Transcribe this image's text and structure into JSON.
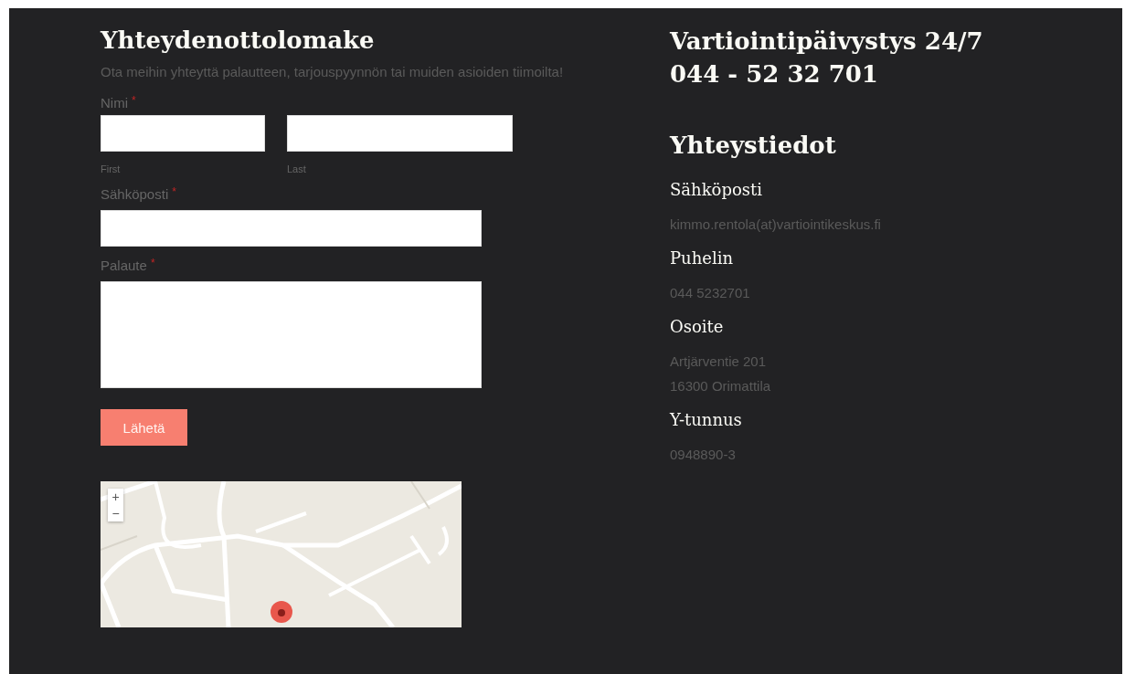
{
  "form": {
    "title": "Yhteydenottolomake",
    "intro": "Ota meihin yhteyttä palautteen, tarjouspyynnön tai muiden asioiden tiimoilta!",
    "fields": [
      {
        "kind": "name",
        "label": "Nimi",
        "required_mark": "*",
        "parts": [
          {
            "sublabel": "First"
          },
          {
            "sublabel": "Last"
          }
        ]
      },
      {
        "kind": "text",
        "label": "Sähköposti",
        "required_mark": "*"
      },
      {
        "kind": "textarea",
        "label": "Palaute",
        "required_mark": "*"
      }
    ],
    "submit": "Lähetä"
  },
  "map": {
    "zoom_in": "+",
    "zoom_out": "−"
  },
  "emergency": {
    "title": "Vartiointipäivystys 24/7",
    "phone": "044 - 52 32 701"
  },
  "contact": {
    "title": "Yhteystiedot",
    "items": [
      {
        "label": "Sähköposti",
        "lines": [
          "kimmo.rentola(at)vartiointikeskus.fi"
        ]
      },
      {
        "label": "Puhelin",
        "lines": [
          "044 5232701"
        ]
      },
      {
        "label": "Osoite",
        "lines": [
          "Artjärventie 201",
          "16300 Orimattila"
        ]
      },
      {
        "label": "Y-tunnus",
        "lines": [
          "0948890-3"
        ]
      }
    ]
  }
}
